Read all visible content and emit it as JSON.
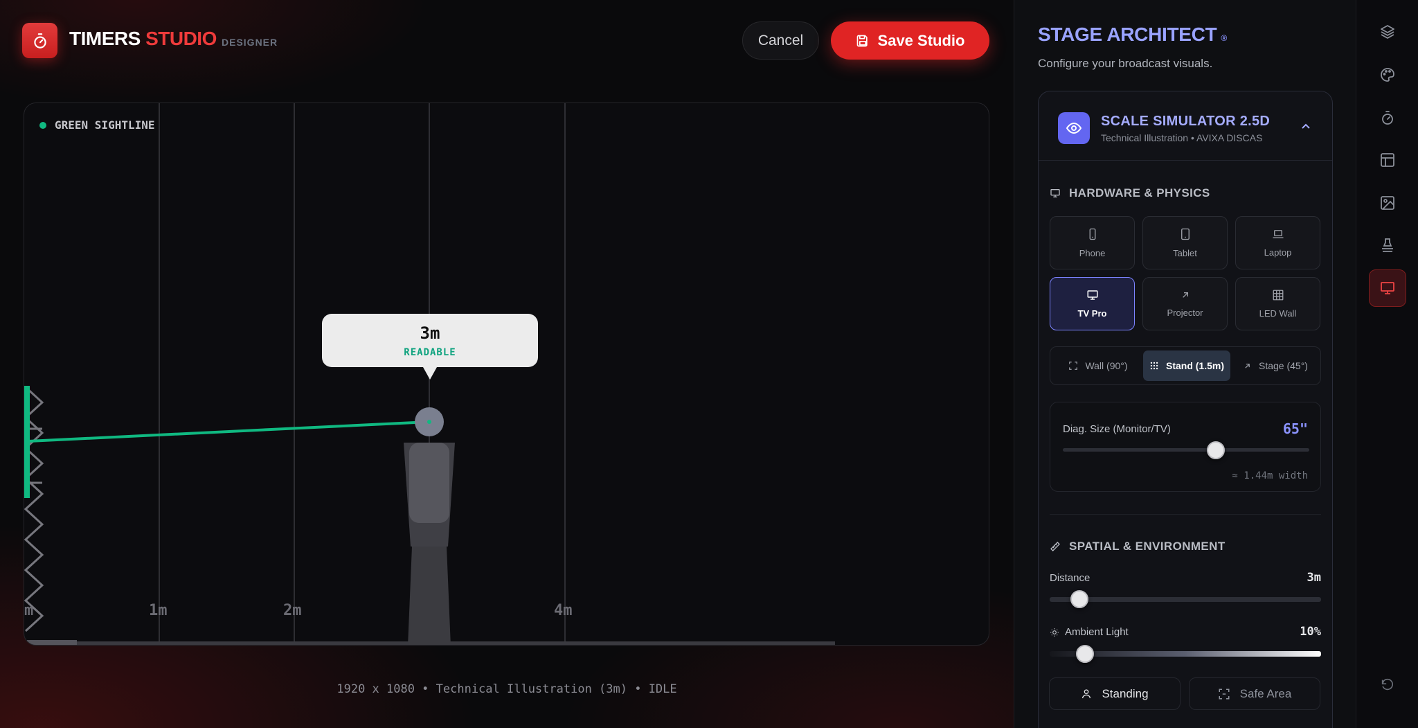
{
  "header": {
    "brand_white": "TIMERS",
    "brand_red": "STUDIO",
    "brand_sub": "DESIGNER",
    "cancel_label": "Cancel",
    "save_label": "Save Studio"
  },
  "canvas": {
    "sightline_label": "GREEN SIGHTLINE",
    "grid_labels": [
      "m",
      "1m",
      "2m",
      "4m"
    ],
    "tooltip_distance": "3m",
    "tooltip_status": "READABLE",
    "footer": "1920 x 1080 • Technical Illustration (3m) • IDLE"
  },
  "panel": {
    "title": "STAGE ARCHITECT",
    "title_mark": "®",
    "subtitle": "Configure your broadcast visuals.",
    "simulator_title": "SCALE SIMULATOR 2.5D",
    "simulator_sub": "Technical Illustration • AVIXA DISCAS",
    "hardware_heading": "HARDWARE & PHYSICS",
    "devices": [
      {
        "label": "Phone",
        "icon": "phone-icon",
        "active": false
      },
      {
        "label": "Tablet",
        "icon": "tablet-icon",
        "active": false
      },
      {
        "label": "Laptop",
        "icon": "laptop-icon",
        "active": false
      },
      {
        "label": "TV Pro",
        "icon": "monitor-icon",
        "active": true
      },
      {
        "label": "Projector",
        "icon": "arrow-up-right-icon",
        "active": false
      },
      {
        "label": "LED Wall",
        "icon": "grid-icon",
        "active": false
      }
    ],
    "mounts": [
      {
        "label": "Wall (90°)",
        "active": false
      },
      {
        "label": "Stand (1.5m)",
        "active": true
      },
      {
        "label": "Stage (45°)",
        "active": false
      }
    ],
    "diag_label": "Diag. Size (Monitor/TV)",
    "diag_value": "65\"",
    "diag_fraction": 0.62,
    "diag_note": "≈ 1.44m width",
    "spatial_heading": "SPATIAL & ENVIRONMENT",
    "distance_label": "Distance",
    "distance_value": "3m",
    "distance_fraction": 0.11,
    "ambient_label": "Ambient Light",
    "ambient_value": "10%",
    "ambient_fraction": 0.13,
    "standing_label": "Standing",
    "safe_area_label": "Safe Area"
  },
  "colors": {
    "accent_red": "#e02424",
    "accent_indigo": "#6366f1",
    "sightline_green": "#10b981"
  }
}
